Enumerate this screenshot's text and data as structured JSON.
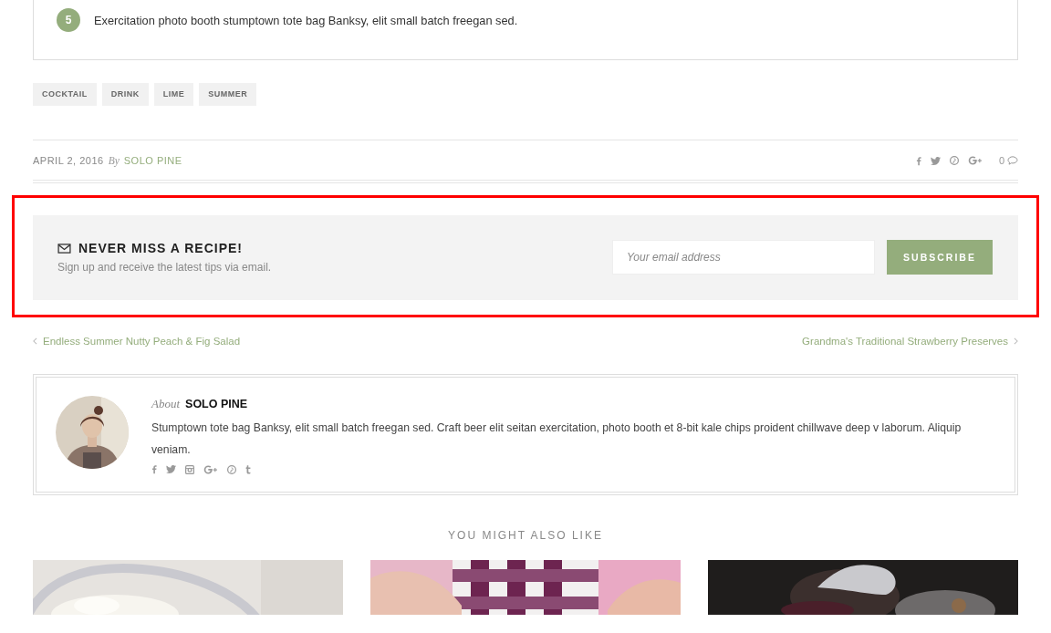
{
  "steps": [
    {
      "number": "5",
      "text": "Exercitation photo booth stumptown tote bag Banksy, elit small batch freegan sed."
    }
  ],
  "tags": [
    "COCKTAIL",
    "DRINK",
    "LIME",
    "SUMMER"
  ],
  "meta": {
    "date": "APRIL 2, 2016",
    "by": "By",
    "author": "SOLO PINE",
    "comments": "0"
  },
  "subscribe": {
    "highlighted": true,
    "title": "NEVER MISS A RECIPE!",
    "subtitle": "Sign up and receive the latest tips via email.",
    "placeholder": "Your email address",
    "button": "SUBSCRIBE"
  },
  "post_nav": {
    "previous": "Endless Summer Nutty Peach & Fig Salad",
    "next": "Grandma's Traditional Strawberry Preserves"
  },
  "author_box": {
    "about": "About",
    "name": "SOLO PINE",
    "bio": "Stumptown tote bag Banksy, elit small batch freegan sed. Craft beer elit seitan exercitation, photo booth et 8-bit kale chips proident chillwave deep v laborum. Aliquip veniam."
  },
  "related": {
    "title": "YOU MIGHT ALSO LIKE"
  }
}
